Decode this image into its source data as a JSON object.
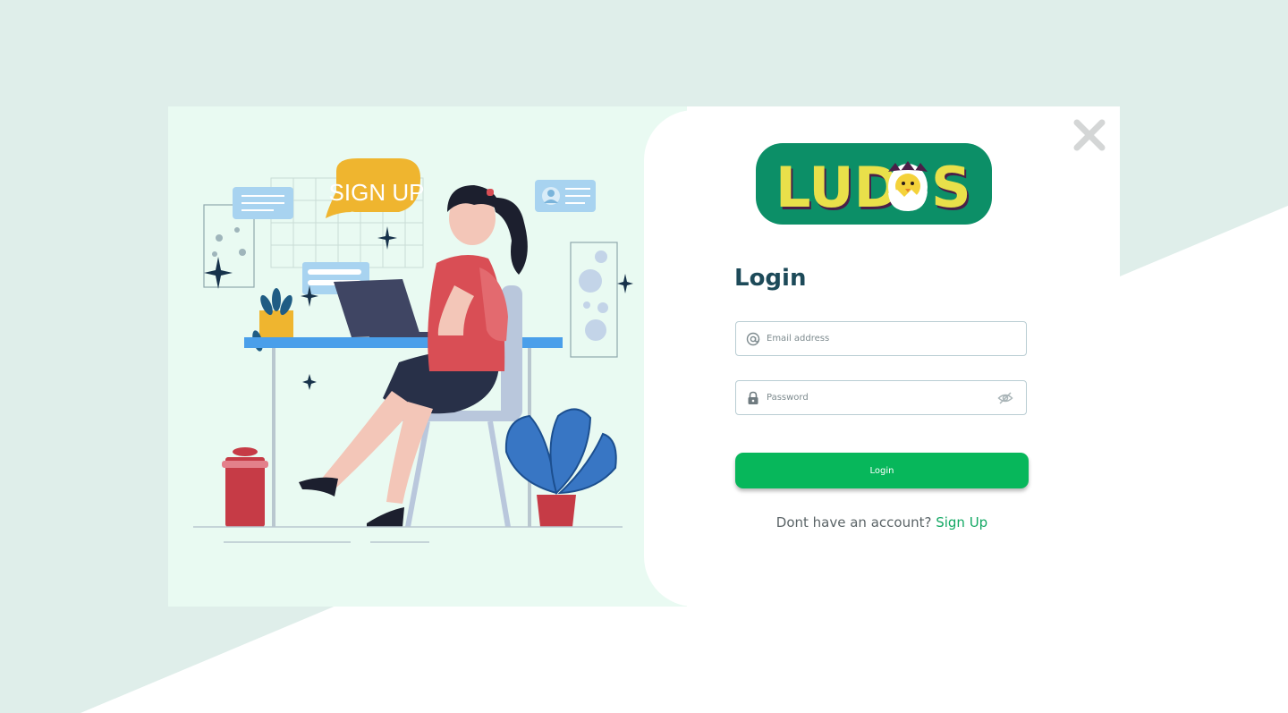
{
  "login": {
    "title": "Login",
    "email_placeholder": "Email address",
    "password_placeholder": "Password",
    "button_label": "Login",
    "prompt_text": "Dont have an account?",
    "signup_link": "Sign Up"
  },
  "illustration": {
    "bubble_text": "SIGN UP"
  },
  "logo": {
    "text_left": "LUD",
    "text_right": "S"
  },
  "colors": {
    "page_background_shape": "#dfeeea",
    "illustration_background": "#e9faf2",
    "logo_background": "#0c8f67",
    "logo_text": "#e9e04a",
    "title": "#1d4a59",
    "accent_green": "#07b75b",
    "link_green": "#13a864"
  },
  "icons": {
    "close": "close-icon",
    "email": "at-sign-icon",
    "password": "lock-icon",
    "visibility": "eye-off-icon"
  }
}
